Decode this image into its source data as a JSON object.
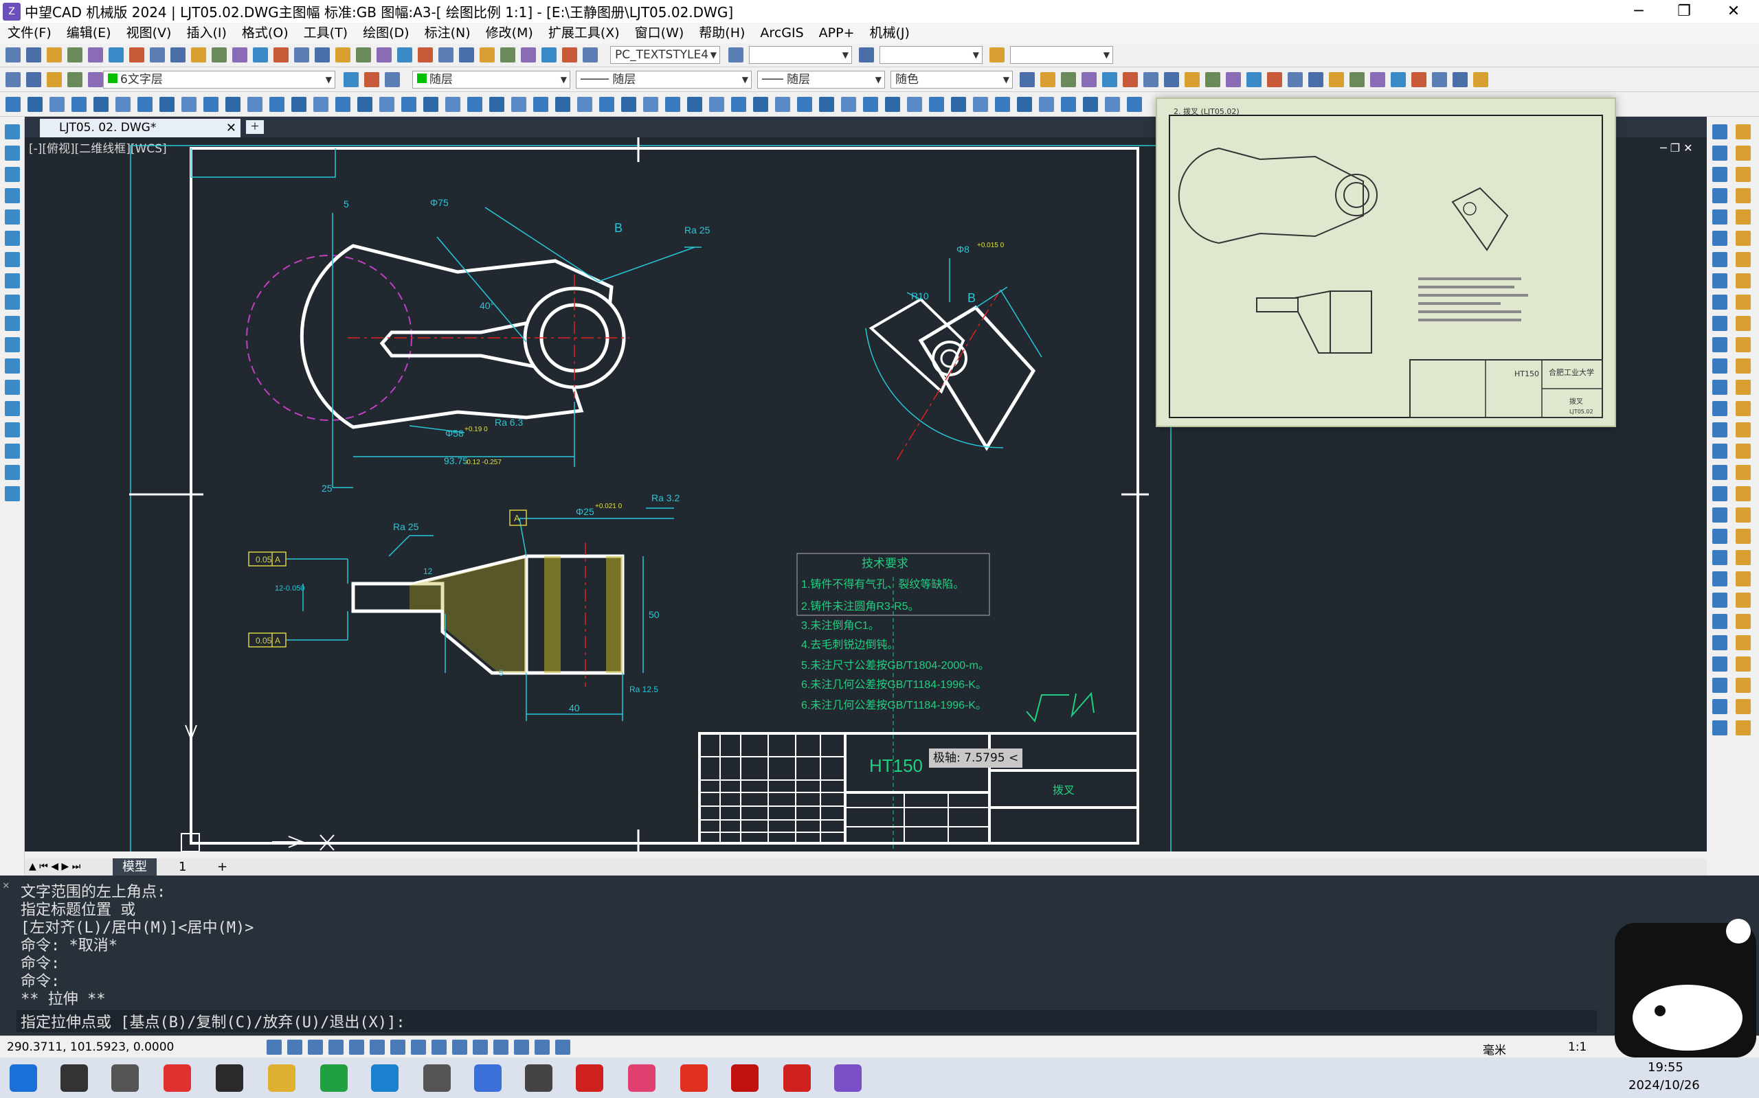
{
  "window": {
    "title": "中望CAD 机械版 2024 | LJT05.02.DWG主图幅  标准:GB 图幅:A3-[ 绘图比例 1:1] - [E:\\王静图册\\LJT05.02.DWG]"
  },
  "menu": [
    "文件(F)",
    "编辑(E)",
    "视图(V)",
    "插入(I)",
    "格式(O)",
    "工具(T)",
    "绘图(D)",
    "标注(N)",
    "修改(M)",
    "扩展工具(X)",
    "窗口(W)",
    "帮助(H)",
    "ArcGIS",
    "APP+",
    "机械(J)"
  ],
  "toolbar": {
    "textstyle": "PC_TEXTSTYLE4",
    "layer": "6文字层",
    "color_combo": "随层",
    "linetype": "随层",
    "lineweight": "随层",
    "plotstyle": "随色"
  },
  "doc": {
    "tab": "LJT05. 02. DWG*",
    "view_label": "[-][俯视][二维线框][WCS]"
  },
  "drawing": {
    "dims": {
      "top_5": "5",
      "phi75": "Φ75",
      "B1": "B",
      "ra25_top": "Ra 25",
      "r40": "40°",
      "phi58": "Φ58",
      "phi58_tol": "+0.19  0",
      "ra63": "Ra 6.3",
      "d9375": "93.75",
      "d9375_tol": "-0.12 -0.257",
      "d25": "25",
      "phi8": "Φ8",
      "phi8_tol": "+0.015  0",
      "r10": "R10",
      "B2": "B",
      "phi25": "Φ25",
      "phi25_tol": "+0.021  0",
      "ra32": "Ra 3.2",
      "ra25_side": "Ra 25",
      "tol1": "0.05",
      "tolA1": "A",
      "tol2": "0.05",
      "tolA2": "A",
      "datumA": "A",
      "d50": "50",
      "d40": "40",
      "d12": "12",
      "ra125": "Ra 12.5",
      "d5": "5",
      "d12_left": "12-0.050"
    },
    "tech": {
      "title": "技术要求",
      "lines": [
        "1.铸件不得有气孔、裂纹等缺陷。",
        "2.铸件未注圆角R3-R5。",
        "3.未注倒角C1。",
        "4.去毛刺锐边倒钝。",
        "5.未注尺寸公差按GB/T1804-2000-m。",
        "6.未注几何公差按GB/T1184-1996-K。",
        "6.未注几何公差按GB/T1184-1996-K。"
      ]
    },
    "titleblock": {
      "material": "HT150",
      "name": "拨叉"
    },
    "tooltip": "极轴: 7.5795 <"
  },
  "thumb": {
    "label": "2. 拨叉 (LJT05.02)",
    "school": "合肥工业大学",
    "part": "拨叉",
    "material": "HT150",
    "code": "LJT05.02"
  },
  "model_tabs": [
    "模型",
    "1"
  ],
  "command": [
    "文字范围的左上角点:",
    "指定标题位置 或",
    "[左对齐(L)/居中(M)]<居中(M)>",
    "命令: *取消*",
    "命令:",
    "命令:",
    "** 拉伸 **",
    "指定拉伸点或 [基点(B)/复制(C)/放弃(U)/退出(X)]:"
  ],
  "status": {
    "coords": "290.3711, 101.5923, 0.0000",
    "unit": "毫米",
    "scale": "1:1"
  },
  "taskbar": {
    "time": "19:55",
    "date": "2024/10/26"
  },
  "colors": {
    "canvas_bg": "#212830",
    "outline": "#ffffff",
    "dim_cyan": "#28c8d8",
    "hidden_magenta": "#c040c0",
    "text_green": "#20d080",
    "center_red": "#e02020"
  }
}
